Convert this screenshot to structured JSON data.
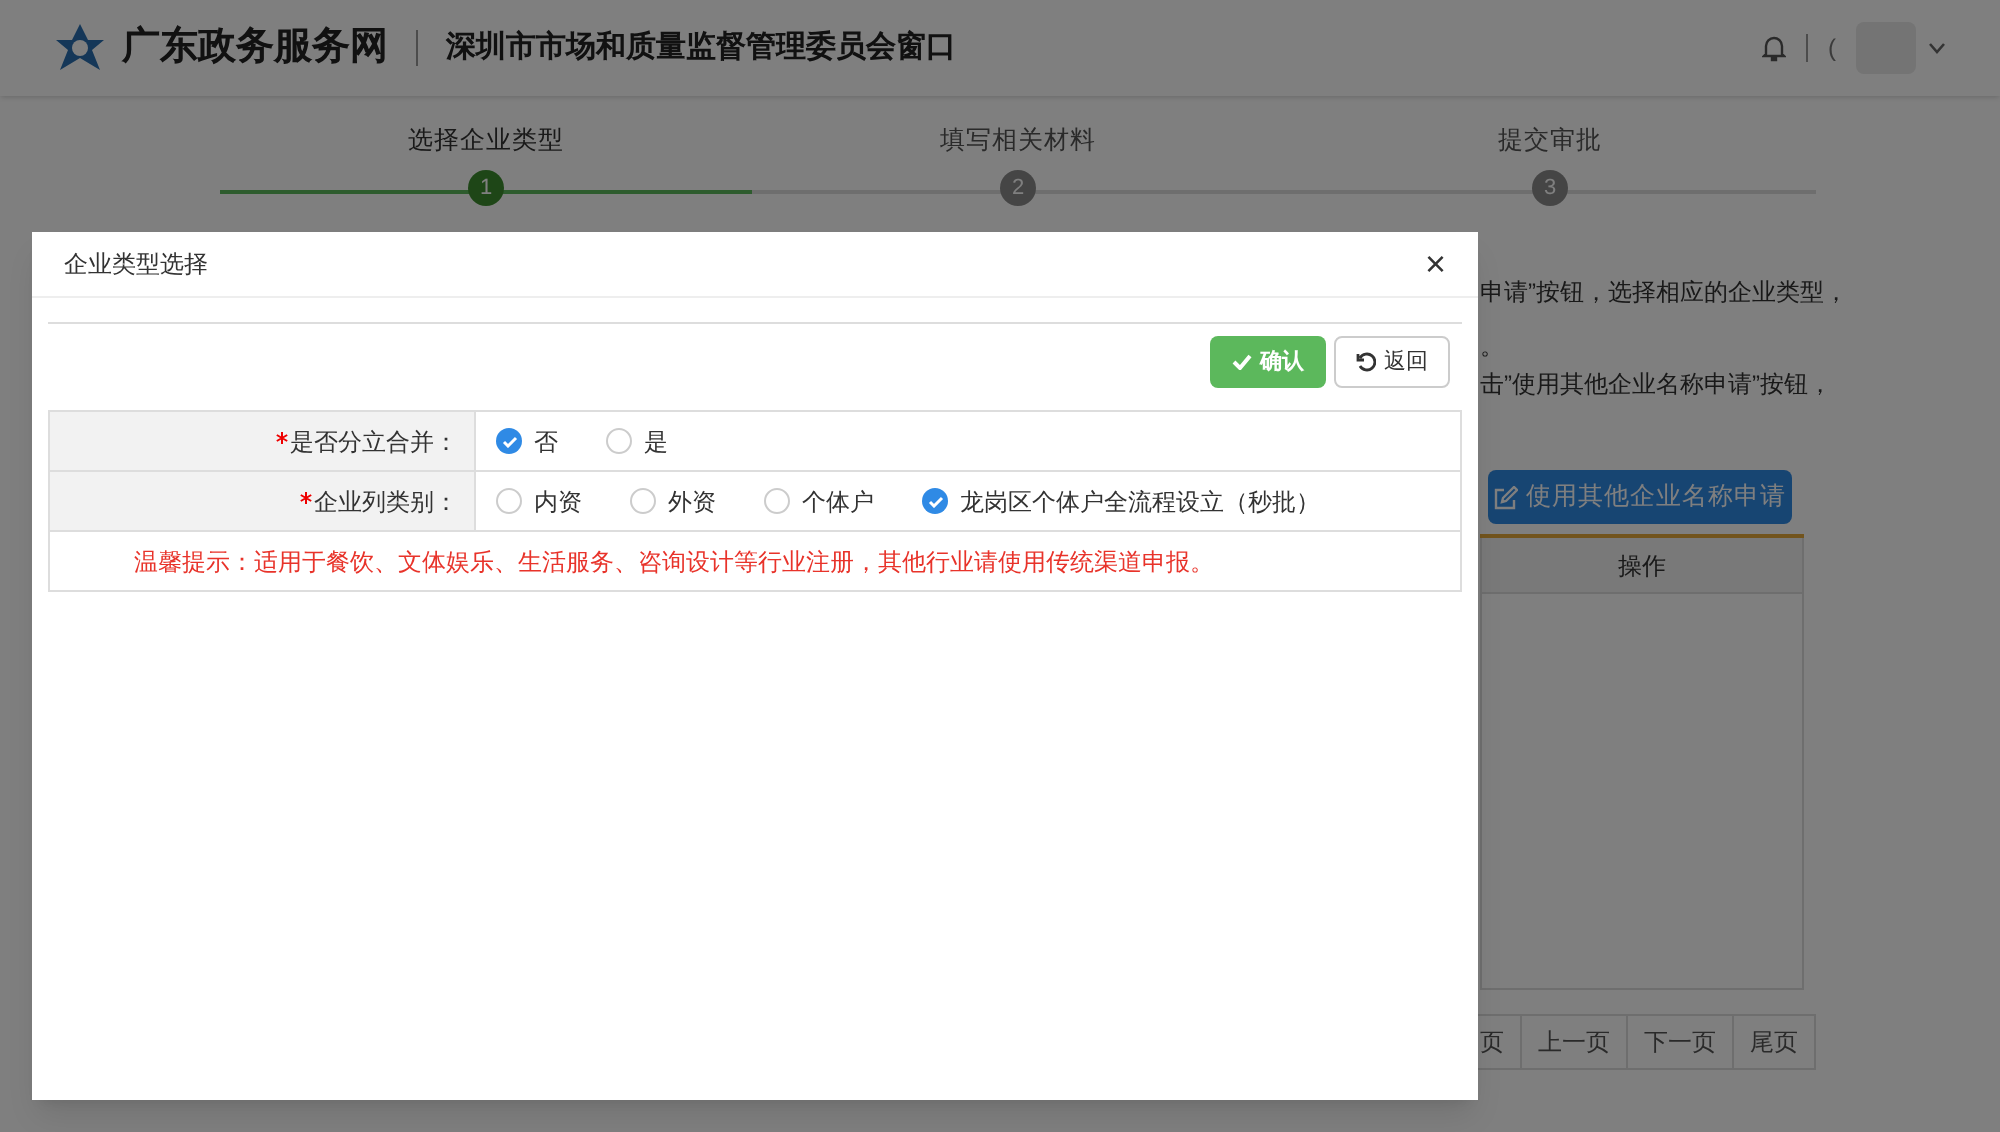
{
  "header": {
    "site_title": "广东政务服务网",
    "window_title": "深圳市市场和质量监督管理委员会窗口",
    "user_prefix": "("
  },
  "steps": [
    {
      "label": "选择企业类型",
      "number": "1",
      "selected": true
    },
    {
      "label": "填写相关材料",
      "number": "2",
      "selected": false
    },
    {
      "label": "提交审批",
      "number": "3",
      "selected": false
    }
  ],
  "background": {
    "instructions": [
      "申请”按钮，选择相应的企业类型，",
      "。",
      "击”使用其他企业名称申请”按钮，"
    ],
    "apply_button": "使用其他企业名称申请",
    "table_columns": [
      "操作"
    ],
    "pagination": [
      "页",
      "上一页",
      "下一页",
      "尾页"
    ]
  },
  "dialog": {
    "title": "企业类型选择",
    "close": "×",
    "buttons": [
      {
        "kind": "confirm",
        "label": "确认"
      },
      {
        "kind": "back",
        "label": "返回"
      }
    ],
    "fields": [
      {
        "label": "是否分立合并：",
        "required": true,
        "options": [
          {
            "label": "否",
            "selected": true
          },
          {
            "label": "是",
            "selected": false
          }
        ]
      },
      {
        "label": "企业列类别：",
        "required": true,
        "options": [
          {
            "label": "内资",
            "selected": false
          },
          {
            "label": "外资",
            "selected": false
          },
          {
            "label": "个体户",
            "selected": false
          },
          {
            "label": "龙岗区个体户全流程设立（秒批）",
            "selected": true
          }
        ]
      }
    ],
    "notice": "温馨提示：适用于餐饮、文体娱乐、生活服务、咨询设计等行业注册，其他行业请使用传统渠道申报。"
  }
}
